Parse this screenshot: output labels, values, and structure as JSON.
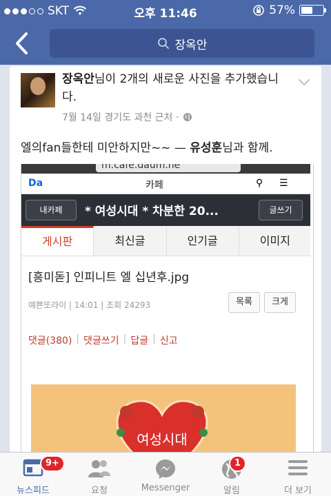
{
  "status": {
    "carrier": "SKT",
    "time": "오후 11:46",
    "battery_pct": "57%",
    "battery_level": 0.57
  },
  "nav": {
    "search_text": "장옥안"
  },
  "post": {
    "author": "장옥안",
    "action_text": "님이 2개의 새로운 사진을 추가했습니다.",
    "meta": "7월 14일 경기도 과천 근처 ·",
    "caption_main": "엘의fan들한테 미안하지만~~ — ",
    "caption_with": "유성훈",
    "caption_end": "님과 함께."
  },
  "photo": {
    "url": "m.cafe.daum.ne",
    "daum": "Da",
    "cafe": "카페",
    "my_cafe": "내카페",
    "cafe_title": "* 여성시대 *  차분한 20...",
    "write": "글쓰기",
    "tabs": [
      "게시판",
      "최신글",
      "인기글",
      "이미지"
    ],
    "post_title": "[흥미돋] 인피니트 엘 십년후.jpg",
    "post_meta": "예쁜또라이  |  14:01  |  조회 24293",
    "btn_list": "목록",
    "btn_big": "크게",
    "links": [
      "댓글(380)",
      "댓글쓰기",
      "답글",
      "신고"
    ],
    "image_text": "여성시대"
  },
  "tabbar": [
    {
      "label": "뉴스피드",
      "icon": "newsfeed-icon",
      "badge": "9+"
    },
    {
      "label": "요청",
      "icon": "friend-requests-icon",
      "badge": ""
    },
    {
      "label": "Messenger",
      "icon": "messenger-icon",
      "badge": ""
    },
    {
      "label": "알림",
      "icon": "globe-notifications-icon",
      "badge": "1"
    },
    {
      "label": "더 보기",
      "icon": "more-menu-icon",
      "badge": ""
    }
  ],
  "colors": {
    "brand": "#4b69a8",
    "badge": "#e0242b"
  }
}
